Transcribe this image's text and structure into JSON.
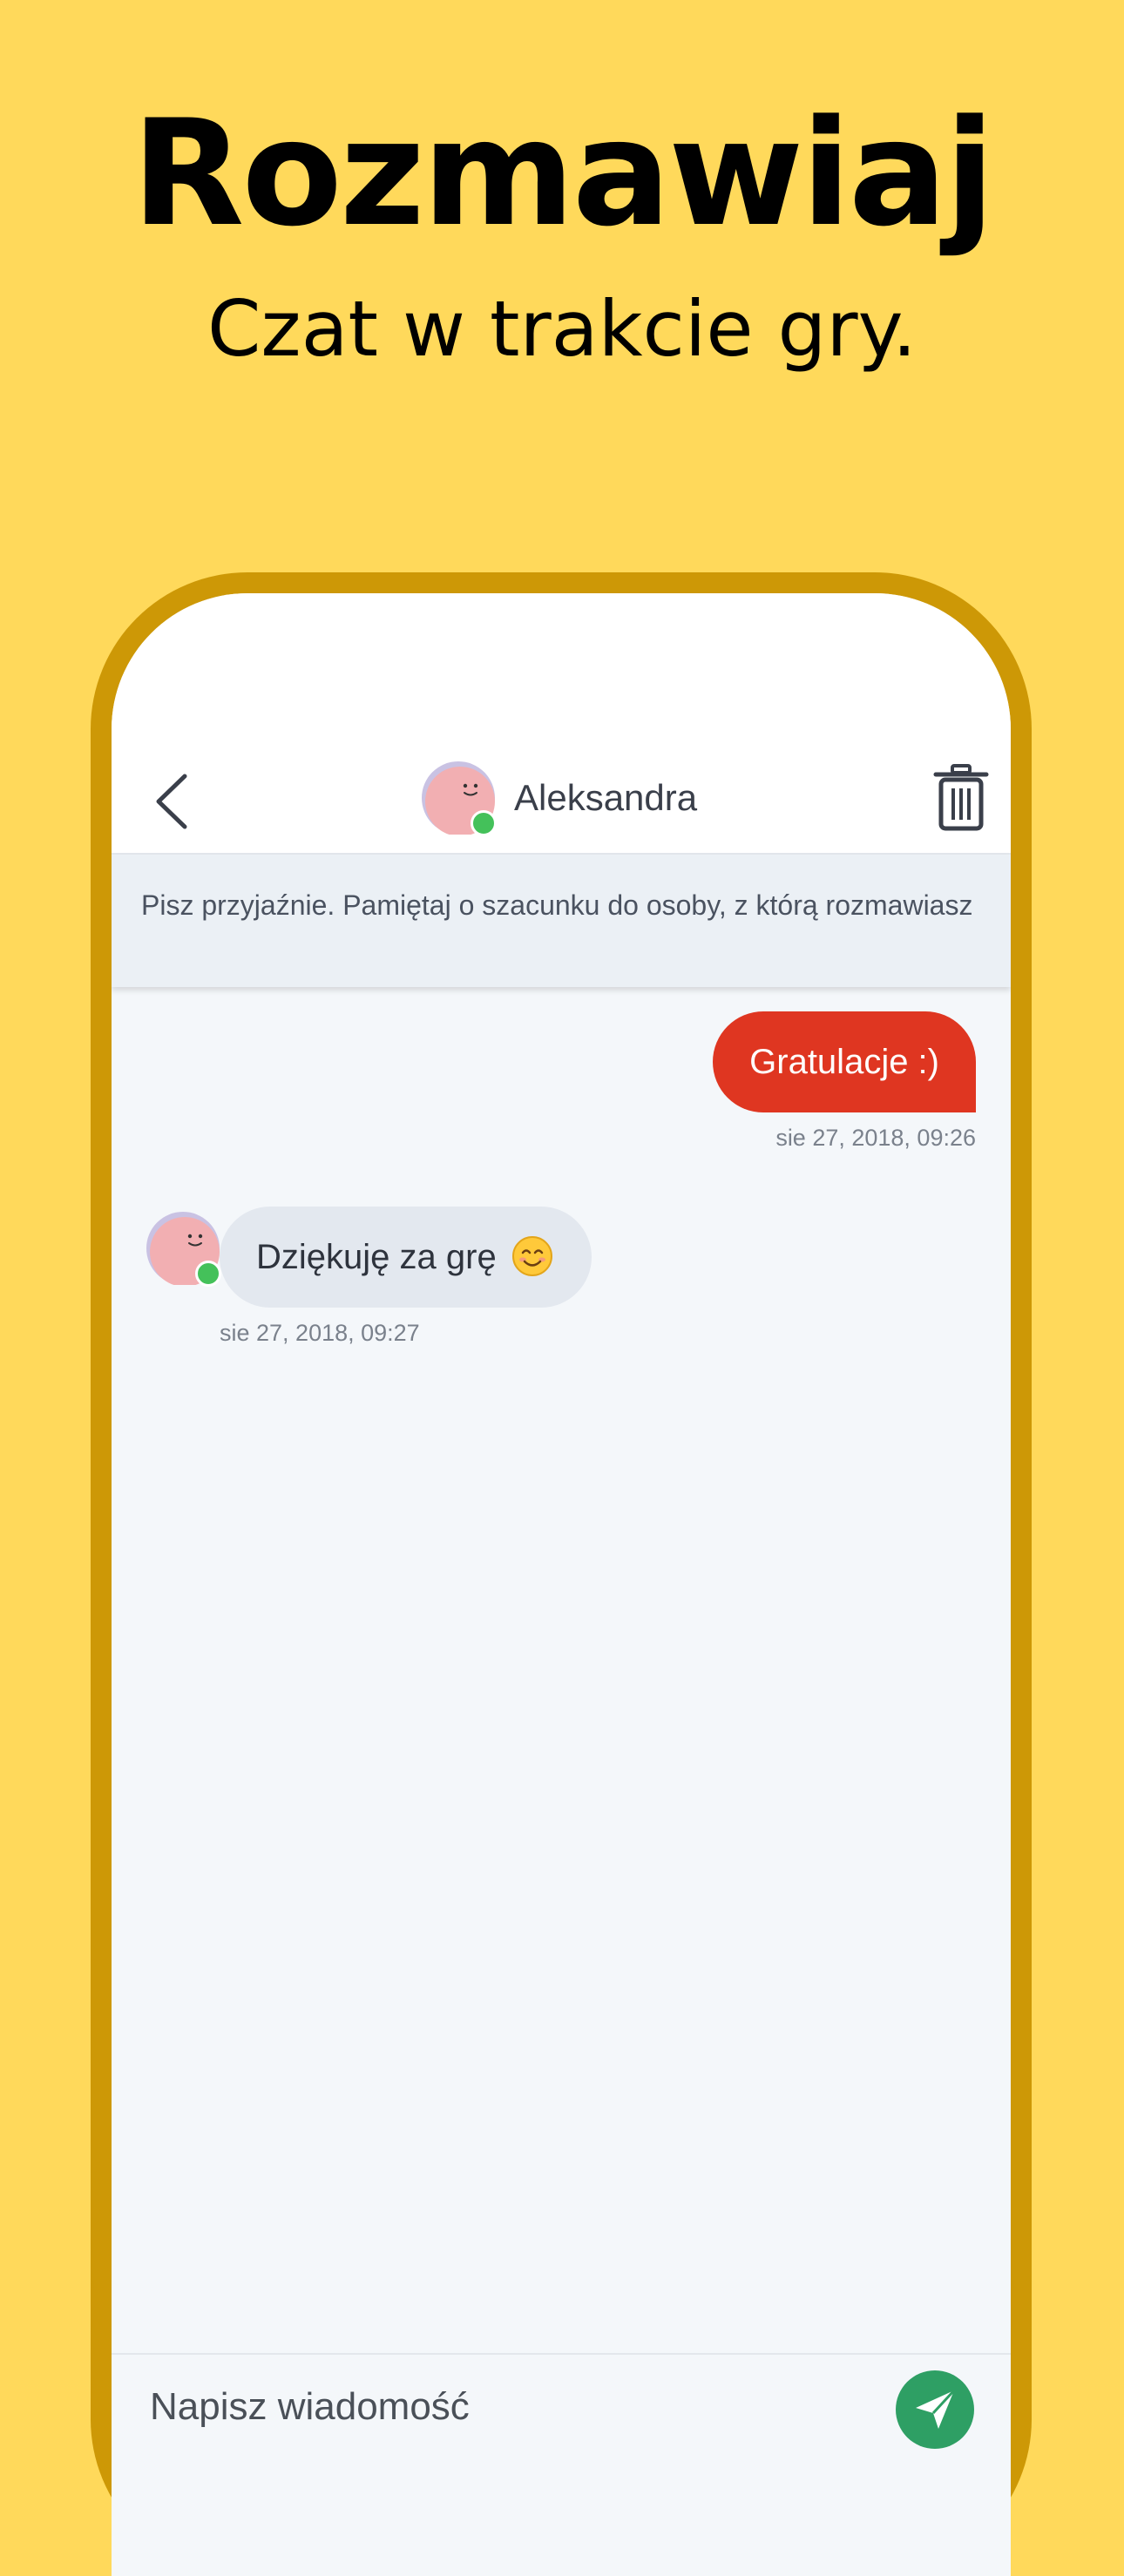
{
  "promo": {
    "title": "Rozmawiaj",
    "subtitle": "Czat w trakcie gry."
  },
  "colors": {
    "background": "#FFD95B",
    "phone_frame": "#CD9806",
    "outgoing_bubble": "#DF3621",
    "incoming_bubble": "#E3E8EF",
    "online_status": "#44C15A",
    "send_button": "#2E9F64"
  },
  "chat": {
    "header": {
      "back_icon": "chevron-left-icon",
      "contact_name": "Aleksandra",
      "contact_online": true,
      "delete_icon": "trash-icon"
    },
    "notice": "Pisz przyjaźnie. Pamiętaj o szacunku do osoby, z którą rozmawiasz",
    "messages": [
      {
        "direction": "outgoing",
        "text": "Gratulacje :)",
        "time": "sie 27, 2018, 09:26"
      },
      {
        "direction": "incoming",
        "text": "Dziękuję za grę",
        "emoji": "smiling-face-icon",
        "time": "sie 27, 2018, 09:27"
      }
    ],
    "composer": {
      "placeholder": "Napisz wiadomość",
      "value": "",
      "send_icon": "paper-plane-icon"
    }
  }
}
